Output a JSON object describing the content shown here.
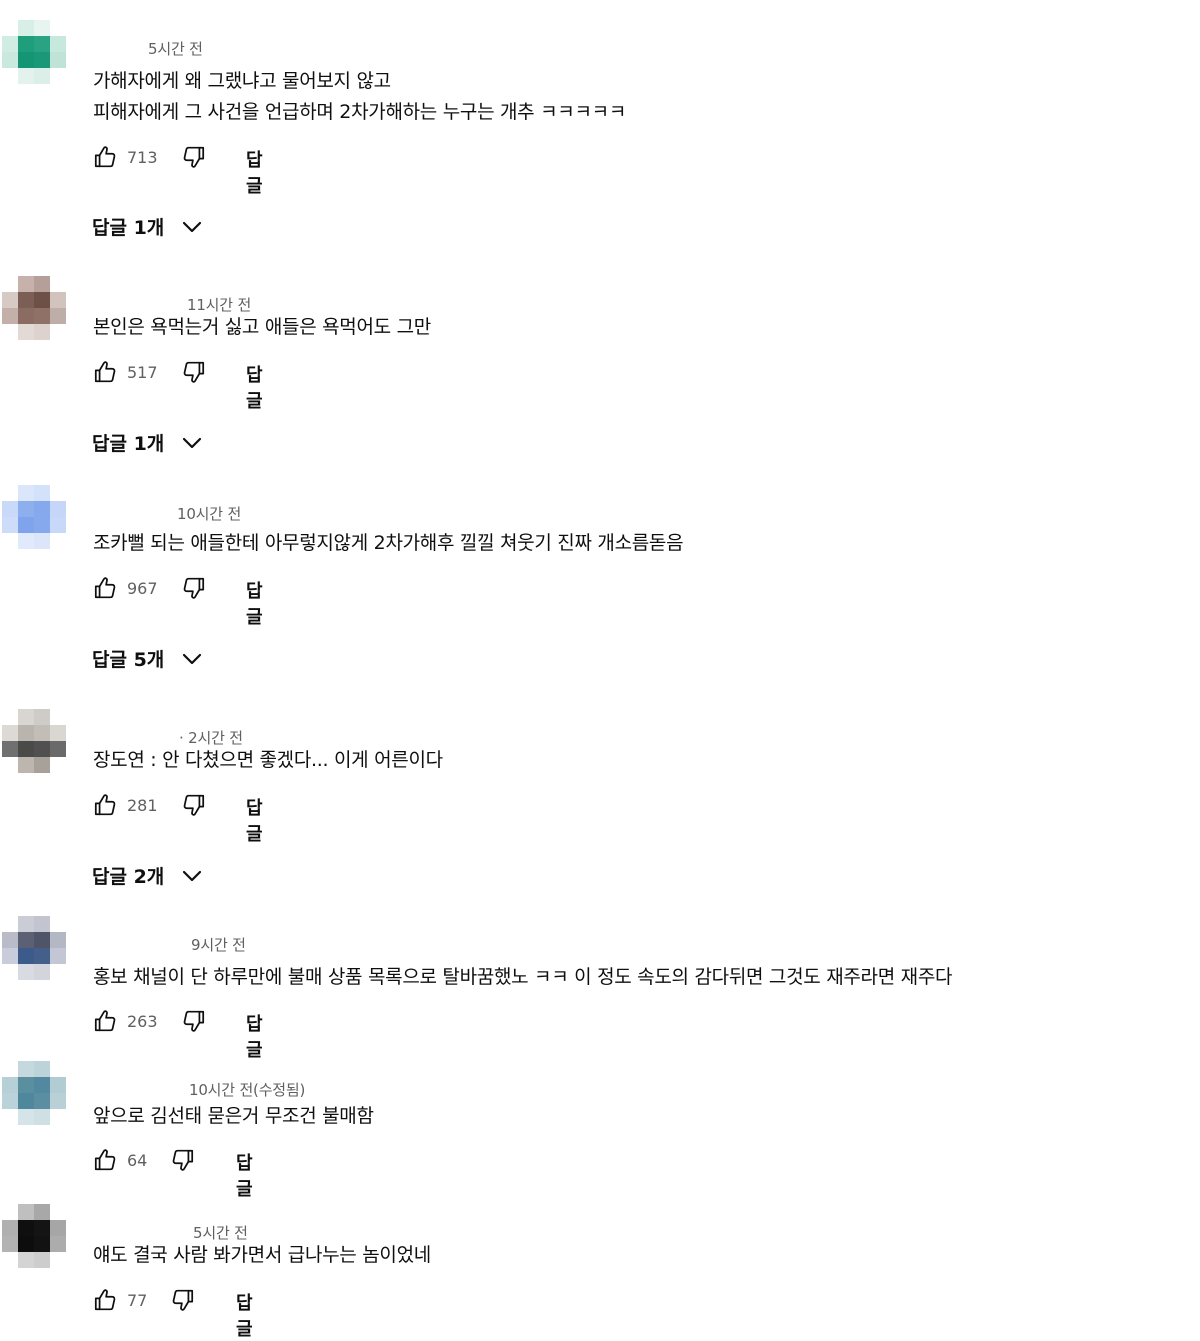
{
  "comments": [
    {
      "timestamp": "5시간 전",
      "lines": [
        "가해자에게 왜 그랬냐고 물어보지 않고",
        "피해자에게 그 사건을 언급하며 2차가해하는 누구는 개추 ㅋㅋㅋㅋㅋ"
      ],
      "likes": "713",
      "reply_label": "답글",
      "replies_label": "답글 1개",
      "avatar_colors": [
        "#ffffff",
        "#d8efe8",
        "#e8f4f0",
        "#ffffff",
        "#d0ece3",
        "#1f9e7c",
        "#2aa383",
        "#c7e8dd",
        "#c9e9de",
        "#149574",
        "#1a9878",
        "#bfe3d6",
        "#ffffff",
        "#e3f2ed",
        "#dceee8",
        "#ffffff"
      ],
      "avatar_icon": "teal-pixel-avatar"
    },
    {
      "timestamp": "11시간 전",
      "lines": [
        "본인은 욕먹는거 싫고 애들은 욕먹어도 그만"
      ],
      "likes": "517",
      "reply_label": "답글",
      "replies_label": "답글 1개",
      "avatar_colors": [
        "#ffffff",
        "#c6b2aa",
        "#b59f98",
        "#ffffff",
        "#d7cac5",
        "#7b5e55",
        "#6d5048",
        "#d2c3bd",
        "#c2b0a9",
        "#8a6c62",
        "#8f7167",
        "#bfaea7",
        "#ffffff",
        "#e3d9d5",
        "#ddd2ce",
        "#ffffff"
      ],
      "avatar_icon": "brown-pixel-avatar"
    },
    {
      "timestamp": "10시간 전",
      "lines": [
        "조카뻘 되는 애들한테 아무렇지않게 2차가해후 낄낄 쳐웃기 진짜 개소름돋음"
      ],
      "likes": "967",
      "reply_label": "답글",
      "replies_label": "답글 5개",
      "avatar_colors": [
        "#ffffff",
        "#dbe6fb",
        "#d4e1fb",
        "#ffffff",
        "#c9d9fa",
        "#8eafee",
        "#86a9ee",
        "#c5d6f8",
        "#cddcf9",
        "#7fa3ec",
        "#86a8ec",
        "#c8d8f9",
        "#ffffff",
        "#e0eafc",
        "#dbe6fb",
        "#ffffff"
      ],
      "avatar_icon": "blue-pixel-avatar"
    },
    {
      "timestamp": "· 2시간 전",
      "lines": [
        "장도연 : 안 다쳤으면 좋겠다... 이게 어른이다"
      ],
      "likes": "281",
      "reply_label": "답글",
      "replies_label": "답글 2개",
      "avatar_colors": [
        "#ffffff",
        "#d9d5d0",
        "#cfcbc6",
        "#ffffff",
        "#ddd9d4",
        "#b9b4ae",
        "#c2bdb7",
        "#dad6d1",
        "#707070",
        "#4a4a48",
        "#505050",
        "#6a6a6a",
        "#ffffff",
        "#bdb6ae",
        "#a8a19a",
        "#ffffff"
      ],
      "avatar_icon": "gray-pixel-avatar"
    },
    {
      "timestamp": "9시간 전",
      "lines": [
        "홍보 채널이 단 하루만에 불매 상품 목록으로 탈바꿈했노 ㅋㅋ 이 정도 속도의 감다뒤면 그것도 재주라면 재주다"
      ],
      "likes": "263",
      "reply_label": "답글",
      "replies_label": "",
      "avatar_colors": [
        "#ffffff",
        "#cbcdd6",
        "#c2c5cf",
        "#ffffff",
        "#b9bcc8",
        "#5b6075",
        "#4f5469",
        "#b4b7c4",
        "#c8ccdb",
        "#3d5b8a",
        "#445f8a",
        "#c3c7d5",
        "#ffffff",
        "#d9dbe2",
        "#d3d5dd",
        "#ffffff"
      ],
      "avatar_icon": "navy-pixel-avatar"
    },
    {
      "timestamp": "10시간 전(수정됨)",
      "lines": [
        "앞으로 김선태 묻은거 무조건 불매함"
      ],
      "likes": "64",
      "reply_label": "답글",
      "replies_label": "",
      "avatar_colors": [
        "#ffffff",
        "#c4d8de",
        "#bcd3da",
        "#ffffff",
        "#b7cfd6",
        "#5a8fa0",
        "#5289a0",
        "#b2ccd4",
        "#bad2d9",
        "#4f889c",
        "#5a8ea0",
        "#b9d0d7",
        "#ffffff",
        "#d5e4e8",
        "#cfe0e5",
        "#ffffff"
      ],
      "avatar_icon": "steel-blue-pixel-avatar"
    },
    {
      "timestamp": "5시간 전",
      "lines": [
        "얘도 결국 사람 봐가면서 급나누는 놈이었네"
      ],
      "likes": "77",
      "reply_label": "답글",
      "replies_label": "",
      "avatar_colors": [
        "#ffffff",
        "#bfbfbf",
        "#a8a8a8",
        "#ffffff",
        "#b0b0b0",
        "#0f0f0f",
        "#141414",
        "#a6a6a6",
        "#b3b3b3",
        "#0d0d0d",
        "#121212",
        "#acacac",
        "#ffffff",
        "#d4d4d4",
        "#cdcdcd",
        "#ffffff"
      ],
      "avatar_icon": "black-pixel-avatar"
    }
  ]
}
